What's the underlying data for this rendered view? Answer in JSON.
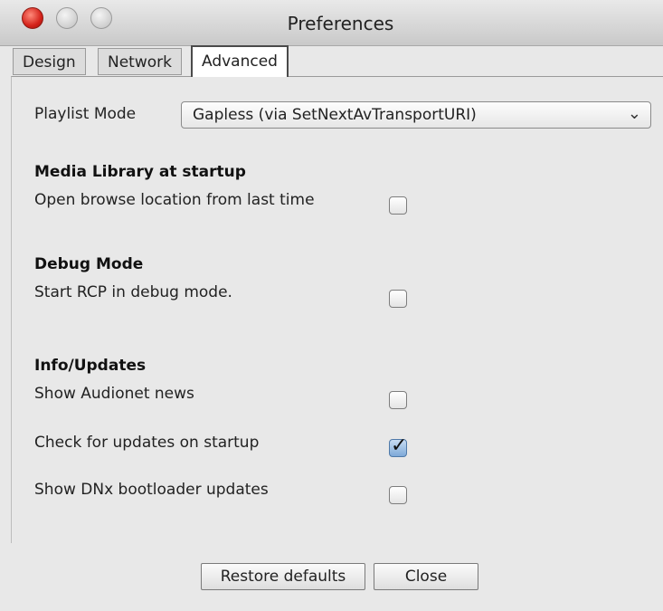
{
  "window": {
    "title": "Preferences"
  },
  "tabs": [
    {
      "label": "Design",
      "selected": false
    },
    {
      "label": "Network",
      "selected": false
    },
    {
      "label": "Advanced",
      "selected": true
    }
  ],
  "playlist": {
    "label": "Playlist Mode",
    "value": "Gapless (via SetNextAvTransportURI)"
  },
  "media_library": {
    "header": "Media Library at startup",
    "open_browse": {
      "label": "Open browse location from last time",
      "checked": false
    }
  },
  "debug": {
    "header": "Debug Mode",
    "start_debug": {
      "label": "Start RCP in debug mode.",
      "checked": false
    }
  },
  "info": {
    "header": "Info/Updates",
    "show_news": {
      "label": "Show Audionet news",
      "checked": false
    },
    "check_updates": {
      "label": "Check for updates on startup",
      "checked": true
    },
    "show_bootloader": {
      "label": "Show DNx bootloader updates",
      "checked": false
    }
  },
  "buttons": {
    "restore": "Restore defaults",
    "close": "Close"
  },
  "icons": {
    "check": "✓",
    "chevron": "⌄"
  }
}
